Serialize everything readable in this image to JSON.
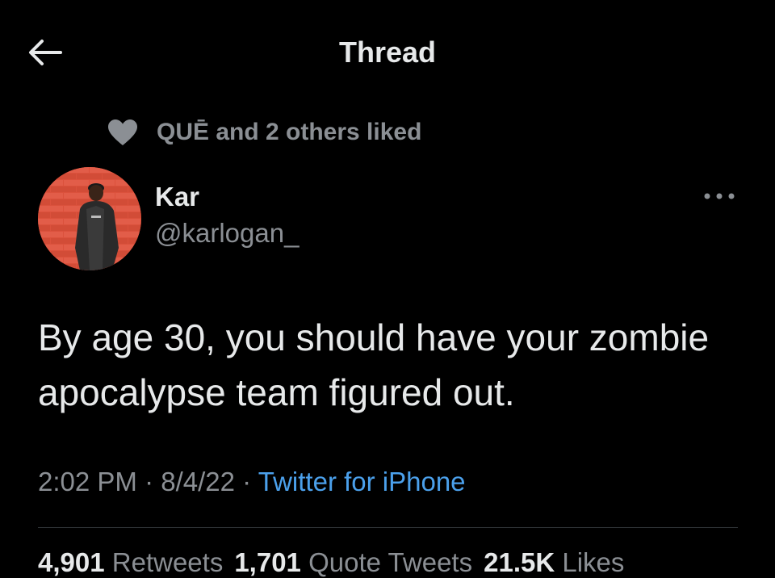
{
  "header": {
    "title": "Thread",
    "back_icon": "arrow-left-icon"
  },
  "social_context": {
    "icon": "heart-icon",
    "text": "QUĒ and 2 others liked"
  },
  "tweet": {
    "author_name": "Kar",
    "author_handle": "@karlogan_",
    "avatar_description": "avatar-photo",
    "more_icon": "more-horizontal-icon",
    "text": "By age 30, you should have your zombie apocalypse team figured out.",
    "time": "2:02 PM",
    "date": "8/4/22",
    "separator": "·",
    "source": "Twitter for iPhone"
  },
  "stats": {
    "retweets_count": "4,901",
    "retweets_label": "Retweets",
    "quote_tweets_count": "1,701",
    "quote_tweets_label": "Quote Tweets",
    "likes_count": "21.5K",
    "likes_label": "Likes"
  },
  "colors": {
    "background": "#000000",
    "text_primary": "#e7e9ea",
    "text_secondary": "#8b8f94",
    "link": "#4ba0eb",
    "divider": "#2f3336"
  }
}
